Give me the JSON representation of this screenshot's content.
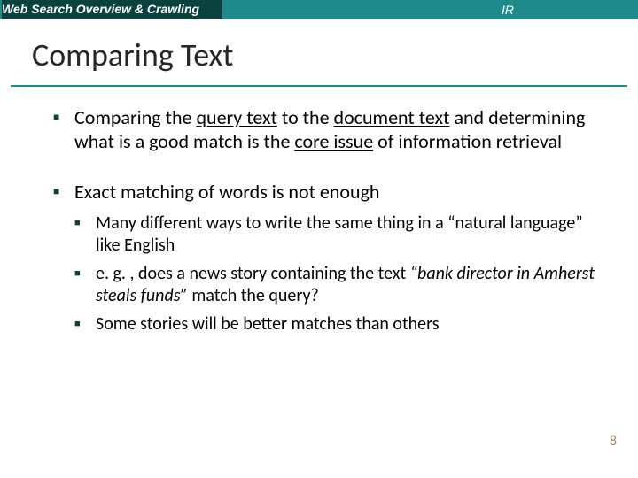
{
  "header": {
    "left": "Web Search Overview & Crawling",
    "right": "IR"
  },
  "title": "Comparing Text",
  "bullets": {
    "b1_pre": "Comparing the ",
    "b1_u1": "query text",
    "b1_mid1": " to the ",
    "b1_u2": "document text",
    "b1_mid2": " and determining what is a good match is the ",
    "b1_u3": "core issue",
    "b1_post": " of information retrieval",
    "b2": "Exact matching of words is not enough",
    "b2_sub1": "Many different ways to write the same thing in a “natural language” like English",
    "b2_sub2_pre": "e. g. , does a news story containing the text ",
    "b2_sub2_em": "“bank director in Amherst steals funds”",
    "b2_sub2_post": " match the query?",
    "b2_sub3": "Some stories will be better matches than others"
  },
  "page_number": "8"
}
